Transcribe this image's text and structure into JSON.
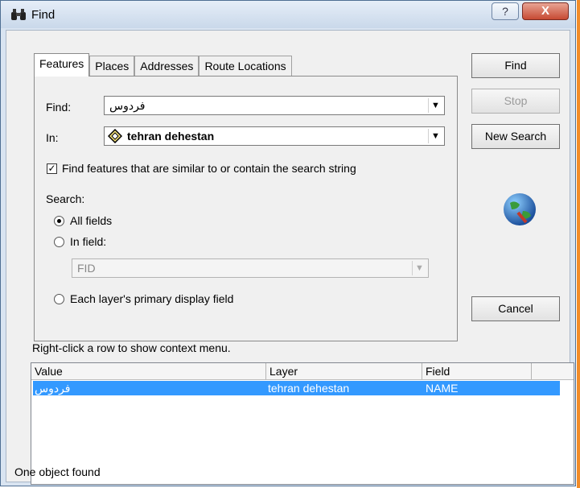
{
  "window": {
    "title": "Find",
    "help_label": "?",
    "close_label": "X"
  },
  "tabs": [
    {
      "label": "Features",
      "active": true
    },
    {
      "label": "Places"
    },
    {
      "label": "Addresses"
    },
    {
      "label": "Route Locations"
    }
  ],
  "form": {
    "find_label": "Find:",
    "find_value": "فردوس",
    "in_label": "In:",
    "in_value": "tehran dehestan",
    "similar_check_label": "Find features that are similar to or contain the search string",
    "search_label": "Search:",
    "radio_all": "All fields",
    "radio_in_field": "In field:",
    "field_value": "FID",
    "radio_primary": "Each layer's primary display field"
  },
  "buttons": {
    "find": "Find",
    "stop": "Stop",
    "new_search": "New Search",
    "cancel": "Cancel"
  },
  "results": {
    "hint": "Right-click a row to show context menu.",
    "columns": [
      "Value",
      "Layer",
      "Field"
    ],
    "rows": [
      {
        "value": "فردوس",
        "layer": "tehran dehestan",
        "field": "NAME"
      }
    ],
    "status": "One object found"
  },
  "colors": {
    "selection": "#3399ff",
    "close_button": "#c74a33",
    "background_accent": "#f28c28"
  }
}
